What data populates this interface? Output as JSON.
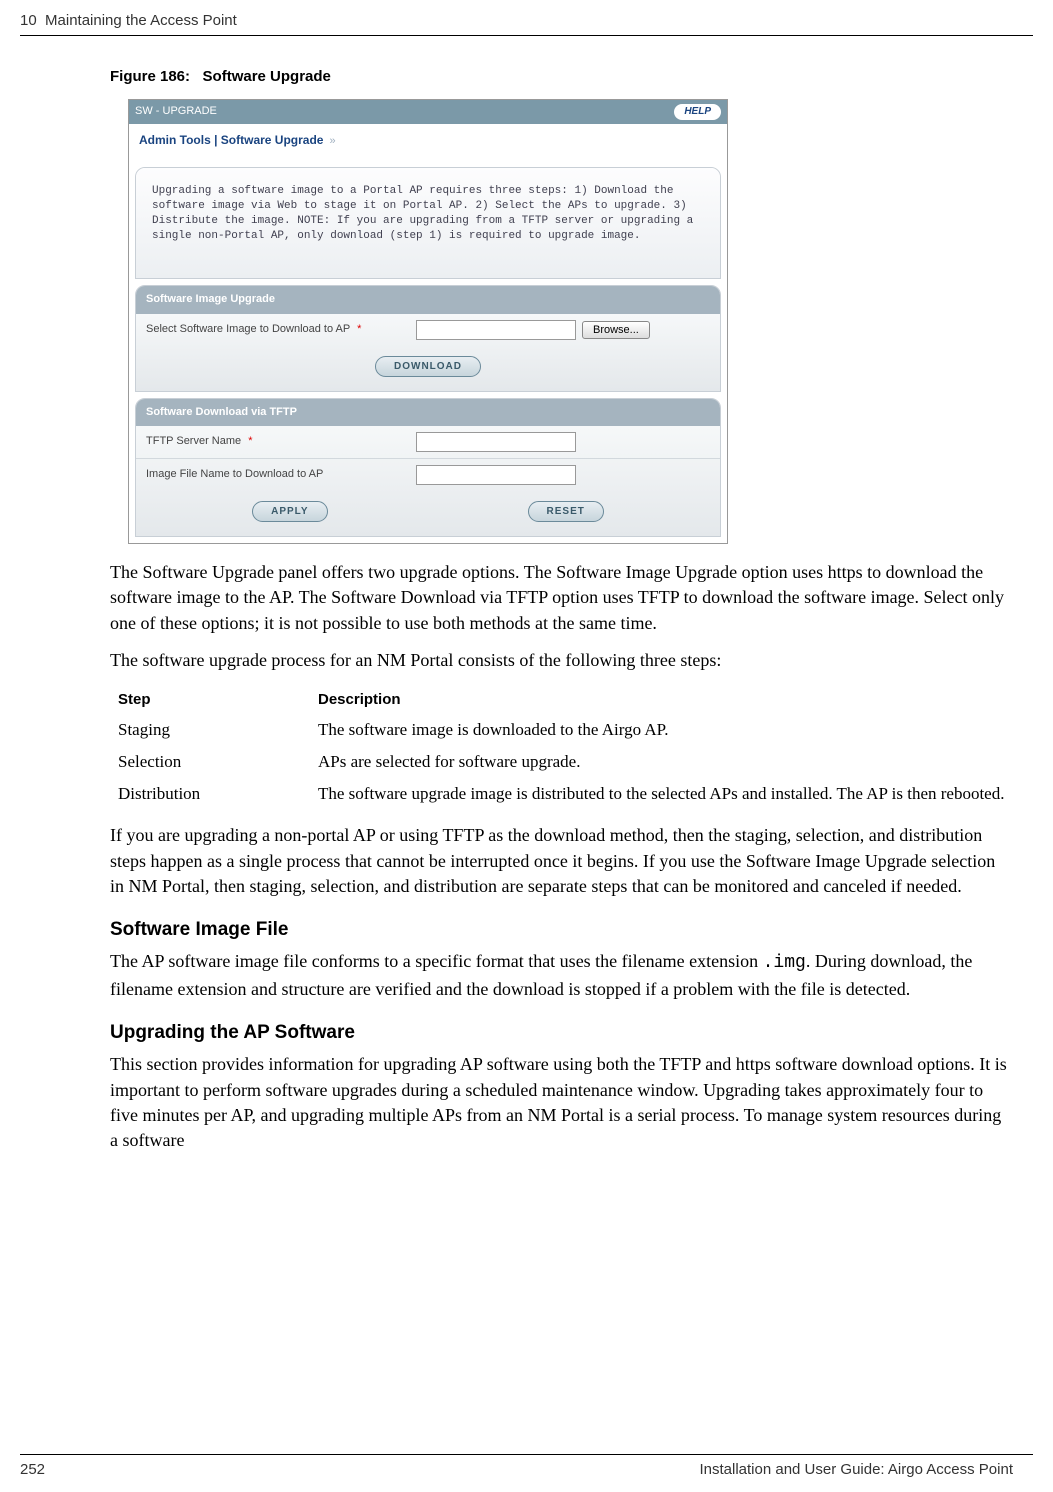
{
  "header": {
    "chapter": "10",
    "chapter_title": "Maintaining the Access Point"
  },
  "figure": {
    "label": "Figure 186:",
    "title": "Software Upgrade"
  },
  "screenshot": {
    "title": "SW - UPGRADE",
    "help": "HELP",
    "breadcrumb": "Admin Tools | Software Upgrade",
    "chevrons": "»",
    "intro": "Upgrading a software image to a Portal AP requires three steps: 1) Download the software image via Web to stage it on Portal AP. 2) Select the APs to upgrade. 3) Distribute the image. NOTE: If you are upgrading from a TFTP server or upgrading a single non-Portal AP, only download (step 1) is required to upgrade image.",
    "section_image": "Software Image Upgrade",
    "label_select_image": "Select Software Image to Download to AP",
    "star": "*",
    "browse": "Browse...",
    "download_btn": "DOWNLOAD",
    "section_tftp": "Software Download via TFTP",
    "label_tftp_server": "TFTP Server Name",
    "label_image_file": "Image File Name to Download to AP",
    "apply_btn": "APPLY",
    "reset_btn": "RESET"
  },
  "para1": "The Software Upgrade panel offers two upgrade options. The Software Image Upgrade option uses https to download the software image to the AP. The Software Download via TFTP option uses TFTP to download the software image. Select only one of these options; it is not possible to use both methods at the same time.",
  "para2": "The software upgrade process for an NM Portal consists of the following three steps:",
  "table": {
    "head_step": "Step",
    "head_desc": "Description",
    "rows": [
      {
        "step": "Staging",
        "desc": "The software image is downloaded to the Airgo AP."
      },
      {
        "step": "Selection",
        "desc": "APs are selected for software upgrade."
      },
      {
        "step": "Distribution",
        "desc": "The software upgrade image is distributed to the selected APs and installed. The AP is then rebooted."
      }
    ]
  },
  "para3": "If you are upgrading a non-portal AP or using TFTP as the download method, then the staging, selection, and distribution steps happen as a single process that cannot be interrupted once it begins. If you use the Software Image Upgrade selection in NM Portal, then staging, selection, and distribution are separate steps that can be monitored and canceled if needed.",
  "section_image_file": {
    "heading": "Software Image File",
    "text_a": "The AP software image file conforms to a specific format that uses the filename extension ",
    "ext": ".img",
    "text_b": ". During download, the filename extension and structure are verified and the download is stopped if a problem with the file is detected."
  },
  "section_upgrade": {
    "heading": "Upgrading the AP Software",
    "text": "This section provides information for upgrading AP software using both the TFTP and https software download options. It is important to perform software upgrades during a scheduled maintenance window. Upgrading takes approximately four to five minutes per AP, and upgrading multiple APs from an NM Portal is a serial process. To manage system resources during a software"
  },
  "footer": {
    "page": "252",
    "title": "Installation and User Guide: Airgo Access Point"
  }
}
